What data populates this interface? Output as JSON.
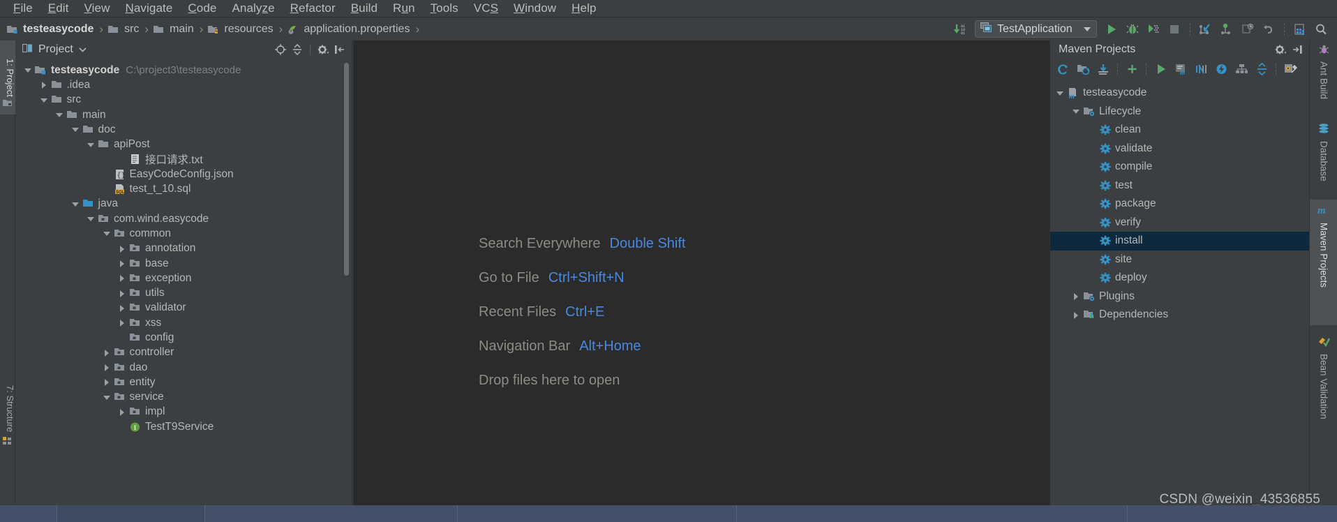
{
  "menu": {
    "items": [
      {
        "label": "File",
        "mnemonic": "F"
      },
      {
        "label": "Edit",
        "mnemonic": "E"
      },
      {
        "label": "View",
        "mnemonic": "V"
      },
      {
        "label": "Navigate",
        "mnemonic": "N"
      },
      {
        "label": "Code",
        "mnemonic": "C"
      },
      {
        "label": "Analyze",
        "mnemonic": "z"
      },
      {
        "label": "Refactor",
        "mnemonic": "R"
      },
      {
        "label": "Build",
        "mnemonic": "B"
      },
      {
        "label": "Run",
        "mnemonic": "u"
      },
      {
        "label": "Tools",
        "mnemonic": "T"
      },
      {
        "label": "VCS",
        "mnemonic": "S"
      },
      {
        "label": "Window",
        "mnemonic": "W"
      },
      {
        "label": "Help",
        "mnemonic": "H"
      }
    ]
  },
  "navbar": {
    "crumbs": [
      {
        "label": "testeasycode",
        "icon": "module-icon",
        "bold": true
      },
      {
        "label": "src",
        "icon": "folder-icon",
        "bold": false
      },
      {
        "label": "main",
        "icon": "folder-icon",
        "bold": false
      },
      {
        "label": "resources",
        "icon": "resources-folder-icon",
        "bold": false
      },
      {
        "label": "application.properties",
        "icon": "spring-properties-icon",
        "bold": false
      }
    ],
    "separator": "›",
    "run_config": {
      "label": "TestApplication",
      "icon": "application-config-icon"
    },
    "toolbar_icons": [
      {
        "name": "update-project-icon",
        "glyph": "binary-download"
      },
      {
        "name": "run-icon",
        "glyph": "play"
      },
      {
        "name": "debug-icon",
        "glyph": "bug"
      },
      {
        "name": "run-with-coverage-icon",
        "glyph": "coverage"
      },
      {
        "name": "stop-icon",
        "glyph": "stop"
      },
      {
        "name": "update-vcs-icon",
        "glyph": "vcs-update"
      },
      {
        "name": "commit-icon",
        "glyph": "vcs-commit"
      },
      {
        "name": "history-icon",
        "glyph": "vcs-history"
      },
      {
        "name": "undo-icon",
        "glyph": "undo"
      },
      {
        "name": "settings-icon",
        "glyph": "settings-grid"
      },
      {
        "name": "search-icon",
        "glyph": "magnifier"
      }
    ]
  },
  "left_strip": {
    "tabs": [
      {
        "label": "1: Project",
        "active": true,
        "icon": "project-icon"
      },
      {
        "label": "7: Structure",
        "active": false,
        "icon": "structure-icon"
      }
    ]
  },
  "project_panel": {
    "title": "Project",
    "header_icons": [
      {
        "name": "locate-icon"
      },
      {
        "name": "collapse-all-icon"
      },
      {
        "name": "gear-icon"
      },
      {
        "name": "hide-panel-icon"
      }
    ],
    "tree": [
      {
        "indent": 0,
        "twisty": "open",
        "icon": "module-icon",
        "label": "testeasycode",
        "path": "C:\\project3\\testeasycode",
        "root": true
      },
      {
        "indent": 1,
        "twisty": "closed",
        "icon": "folder-icon",
        "label": ".idea"
      },
      {
        "indent": 1,
        "twisty": "open",
        "icon": "folder-icon",
        "label": "src"
      },
      {
        "indent": 2,
        "twisty": "open",
        "icon": "folder-icon",
        "label": "main"
      },
      {
        "indent": 3,
        "twisty": "open",
        "icon": "folder-icon",
        "label": "doc"
      },
      {
        "indent": 4,
        "twisty": "open",
        "icon": "folder-icon",
        "label": "apiPost"
      },
      {
        "indent": 6,
        "twisty": "none",
        "icon": "txt-file-icon",
        "label": "接口请求.txt"
      },
      {
        "indent": 5,
        "twisty": "none",
        "icon": "json-file-icon",
        "label": "EasyCodeConfig.json"
      },
      {
        "indent": 5,
        "twisty": "none",
        "icon": "sql-file-icon",
        "label": "test_t_10.sql"
      },
      {
        "indent": 3,
        "twisty": "open",
        "icon": "source-folder-icon",
        "label": "java"
      },
      {
        "indent": 4,
        "twisty": "open",
        "icon": "package-icon",
        "label": "com.wind.easycode"
      },
      {
        "indent": 5,
        "twisty": "open",
        "icon": "package-icon",
        "label": "common"
      },
      {
        "indent": 6,
        "twisty": "closed",
        "icon": "package-icon",
        "label": "annotation"
      },
      {
        "indent": 6,
        "twisty": "closed",
        "icon": "package-icon",
        "label": "base"
      },
      {
        "indent": 6,
        "twisty": "closed",
        "icon": "package-icon",
        "label": "exception"
      },
      {
        "indent": 6,
        "twisty": "closed",
        "icon": "package-icon",
        "label": "utils"
      },
      {
        "indent": 6,
        "twisty": "closed",
        "icon": "package-icon",
        "label": "validator"
      },
      {
        "indent": 6,
        "twisty": "closed",
        "icon": "package-icon",
        "label": "xss"
      },
      {
        "indent": 6,
        "twisty": "none",
        "icon": "package-icon",
        "label": "config"
      },
      {
        "indent": 5,
        "twisty": "closed",
        "icon": "package-icon",
        "label": "controller"
      },
      {
        "indent": 5,
        "twisty": "closed",
        "icon": "package-icon",
        "label": "dao"
      },
      {
        "indent": 5,
        "twisty": "closed",
        "icon": "package-icon",
        "label": "entity"
      },
      {
        "indent": 5,
        "twisty": "open",
        "icon": "package-icon",
        "label": "service"
      },
      {
        "indent": 6,
        "twisty": "closed",
        "icon": "package-icon",
        "label": "impl"
      },
      {
        "indent": 6,
        "twisty": "none",
        "icon": "interface-icon",
        "label": "TestT9Service"
      }
    ]
  },
  "editor": {
    "welcome_shortcuts": [
      {
        "name": "Search Everywhere",
        "key": "Double Shift"
      },
      {
        "name": "Go to File",
        "key": "Ctrl+Shift+N"
      },
      {
        "name": "Recent Files",
        "key": "Ctrl+E"
      },
      {
        "name": "Navigation Bar",
        "key": "Alt+Home"
      },
      {
        "name": "Drop files here to open",
        "key": ""
      }
    ]
  },
  "maven_panel": {
    "title": "Maven Projects",
    "header_icons": [
      {
        "name": "gear-icon"
      },
      {
        "name": "hide-panel-icon"
      }
    ],
    "toolbar_icons": [
      {
        "name": "reimport-icon"
      },
      {
        "name": "generate-sources-icon"
      },
      {
        "name": "download-sources-icon"
      },
      {
        "name": "add-maven-project-icon"
      },
      {
        "name": "run-maven-build-icon"
      },
      {
        "name": "execute-goal-icon"
      },
      {
        "name": "toggle-skip-tests-icon"
      },
      {
        "name": "toggle-offline-icon"
      },
      {
        "name": "show-dependencies-icon"
      },
      {
        "name": "collapse-all-icon"
      },
      {
        "name": "maven-settings-icon"
      }
    ],
    "tree": [
      {
        "indent": 0,
        "twisty": "open",
        "icon": "maven-project-icon",
        "label": "testeasycode",
        "selected": false
      },
      {
        "indent": 1,
        "twisty": "open",
        "icon": "lifecycle-folder-icon",
        "label": "Lifecycle",
        "selected": false
      },
      {
        "indent": 2,
        "twisty": "none",
        "icon": "goal-icon",
        "label": "clean",
        "selected": false
      },
      {
        "indent": 2,
        "twisty": "none",
        "icon": "goal-icon",
        "label": "validate",
        "selected": false
      },
      {
        "indent": 2,
        "twisty": "none",
        "icon": "goal-icon",
        "label": "compile",
        "selected": false
      },
      {
        "indent": 2,
        "twisty": "none",
        "icon": "goal-icon",
        "label": "test",
        "selected": false
      },
      {
        "indent": 2,
        "twisty": "none",
        "icon": "goal-icon",
        "label": "package",
        "selected": false
      },
      {
        "indent": 2,
        "twisty": "none",
        "icon": "goal-icon",
        "label": "verify",
        "selected": false
      },
      {
        "indent": 2,
        "twisty": "none",
        "icon": "goal-icon",
        "label": "install",
        "selected": true
      },
      {
        "indent": 2,
        "twisty": "none",
        "icon": "goal-icon",
        "label": "site",
        "selected": false
      },
      {
        "indent": 2,
        "twisty": "none",
        "icon": "goal-icon",
        "label": "deploy",
        "selected": false
      },
      {
        "indent": 1,
        "twisty": "closed",
        "icon": "plugins-folder-icon",
        "label": "Plugins",
        "selected": false
      },
      {
        "indent": 1,
        "twisty": "closed",
        "icon": "dependencies-folder-icon",
        "label": "Dependencies",
        "selected": false
      }
    ]
  },
  "right_strip": {
    "tabs": [
      {
        "label": "Ant Build",
        "active": false,
        "icon": "ant-icon"
      },
      {
        "label": "Database",
        "active": false,
        "icon": "database-icon"
      },
      {
        "label": "Maven Projects",
        "active": true,
        "icon": "maven-icon"
      },
      {
        "label": "Bean Validation",
        "active": false,
        "icon": "bean-validation-icon"
      }
    ]
  },
  "watermark": "CSDN @weixin_43536855",
  "colors": {
    "panel_bg": "#3c3f41",
    "editor_bg": "#2b2b2b",
    "selection_bg": "#0d293e",
    "accent_blue": "#3592c4",
    "link_blue": "#4a88e0",
    "text": "#b6b6b6",
    "taskbar": "#44506a"
  }
}
